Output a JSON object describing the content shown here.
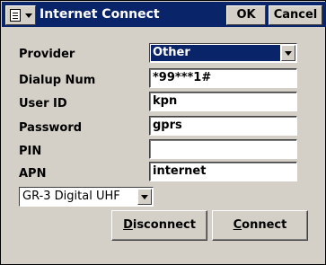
{
  "window": {
    "title": "Internet Connect",
    "ok_label": "OK",
    "cancel_label": "Cancel"
  },
  "form": {
    "provider": {
      "label": "Provider",
      "value": "Other"
    },
    "dialup": {
      "label": "Dialup Num",
      "value": "*99***1#"
    },
    "userid": {
      "label": "User ID",
      "value": "kpn"
    },
    "password": {
      "label": "Password",
      "value": "gprs"
    },
    "pin": {
      "label": "PIN",
      "value": ""
    },
    "apn": {
      "label": "APN",
      "value": "internet"
    },
    "modem": {
      "value": "GR-3 Digital UHF"
    }
  },
  "actions": {
    "disconnect": {
      "first": "D",
      "rest": "isconnect"
    },
    "connect": {
      "first": "C",
      "rest": "onnect"
    }
  },
  "colors": {
    "titlebar": "#0a246a",
    "selection": "#0a246a",
    "face": "#d4d0c8"
  },
  "icons": {
    "system_menu": "document-menu-icon",
    "dropdown": "chevron-down-icon"
  }
}
